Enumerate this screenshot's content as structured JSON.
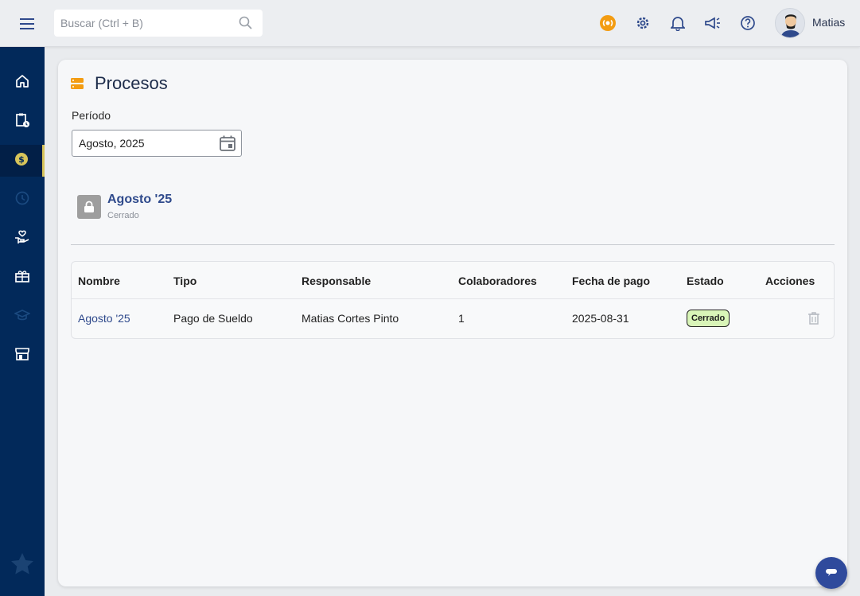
{
  "header": {
    "search_placeholder": "Buscar (Ctrl + B)",
    "user_name": "Matias",
    "icons": [
      "menu-icon",
      "search-icon",
      "live-icon",
      "gear-icon",
      "bell-icon",
      "megaphone-icon",
      "help-icon"
    ]
  },
  "sidebar": {
    "items": [
      {
        "icon": "home-icon"
      },
      {
        "icon": "clipboard-clock-icon"
      },
      {
        "icon": "dollar-coin-icon",
        "active": true
      },
      {
        "icon": "clock-icon",
        "disabled": true
      },
      {
        "icon": "hand-heart-icon"
      },
      {
        "icon": "gift-box-icon"
      },
      {
        "icon": "graduation-cap-icon",
        "disabled": true
      },
      {
        "icon": "store-icon"
      }
    ],
    "footer_icon": "star-icon"
  },
  "page": {
    "title": "Procesos",
    "period_label": "Período",
    "period_value": "Agosto, 2025"
  },
  "process_card": {
    "name": "Agosto '25",
    "status": "Cerrado"
  },
  "table": {
    "headers": [
      "Nombre",
      "Tipo",
      "Responsable",
      "Colaboradores",
      "Fecha de pago",
      "Estado",
      "Acciones"
    ],
    "rows": [
      {
        "nombre": "Agosto '25",
        "tipo": "Pago de Sueldo",
        "responsable": "Matias Cortes Pinto",
        "colaboradores": "1",
        "fecha": "2025-08-31",
        "estado": "Cerrado"
      }
    ]
  },
  "colors": {
    "sidebar_bg": "#02295a",
    "accent_orange": "#f39c12",
    "link_blue": "#2f4a8c",
    "badge_green": "#d9f5b8"
  }
}
